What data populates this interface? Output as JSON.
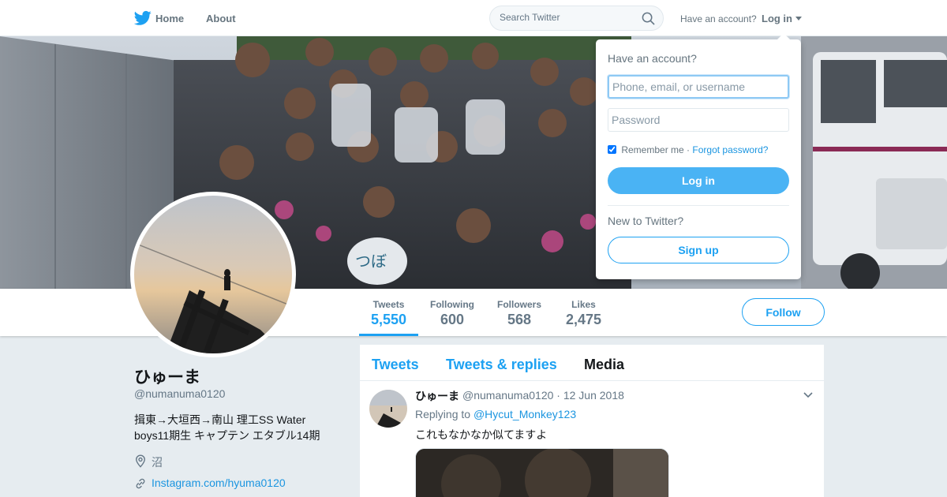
{
  "topnav": {
    "home_label": "Home",
    "about_label": "About",
    "search_placeholder": "Search Twitter",
    "have_account_text": "Have an account?",
    "login_label": "Log in"
  },
  "profile_nav": {
    "stats": [
      {
        "label": "Tweets",
        "value": "5,550"
      },
      {
        "label": "Following",
        "value": "600"
      },
      {
        "label": "Followers",
        "value": "568"
      },
      {
        "label": "Likes",
        "value": "2,475"
      }
    ],
    "follow_label": "Follow"
  },
  "profile": {
    "name": "ひゅーま",
    "handle": "@numanuma0120",
    "bio": "揖東→大垣西→南山 理工SS Water boys11期生 キャプテン エタブル14期",
    "location": "沼",
    "link": "Instagram.com/hyuma0120"
  },
  "timeline": {
    "tabs": [
      "Tweets",
      "Tweets & replies",
      "Media"
    ],
    "tweet": {
      "name": "ひゅーま",
      "handle_date": "@numanuma0120 · 12 Jun 2018",
      "replying_prefix": "Replying to",
      "replying_to": "@Hycut_Monkey123",
      "text": "これもなかなか似てますよ"
    }
  },
  "login_dropdown": {
    "title": "Have an account?",
    "username_placeholder": "Phone, email, or username",
    "password_placeholder": "Password",
    "remember_label": "Remember me",
    "separator": "·",
    "forgot_label": "Forgot password?",
    "login_button": "Log in",
    "new_text": "New to Twitter?",
    "signup_button": "Sign up"
  },
  "colors": {
    "accent": "#1da1f2",
    "background": "#e6ecf0",
    "login_button": "#4ab3f4"
  }
}
